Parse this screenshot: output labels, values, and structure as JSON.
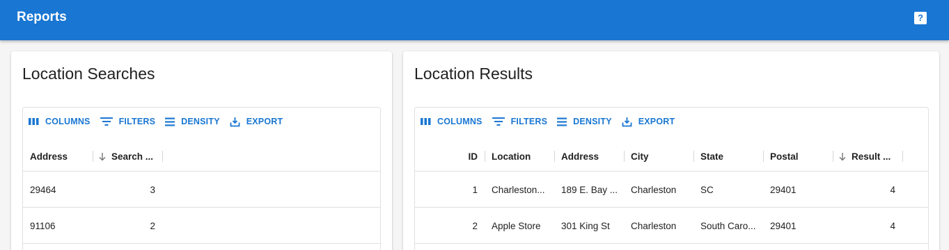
{
  "appbar": {
    "title": "Reports",
    "help_label": "?"
  },
  "toolbar": {
    "columns": "COLUMNS",
    "filters": "FILTERS",
    "density": "DENSITY",
    "export": "EXPORT"
  },
  "searches": {
    "title": "Location Searches",
    "headers": {
      "address": "Address",
      "search_count": "Search ..."
    },
    "rows": [
      {
        "address": "29464",
        "count": "3"
      },
      {
        "address": "91106",
        "count": "2"
      }
    ]
  },
  "results": {
    "title": "Location Results",
    "headers": {
      "id": "ID",
      "location": "Location",
      "address": "Address",
      "city": "City",
      "state": "State",
      "postal": "Postal",
      "result_count": "Result ..."
    },
    "rows": [
      {
        "id": "1",
        "location": "Charleston...",
        "address": "189 E. Bay ...",
        "city": "Charleston",
        "state": "SC",
        "postal": "29401",
        "count": "4"
      },
      {
        "id": "2",
        "location": "Apple Store",
        "address": "301 King St",
        "city": "Charleston",
        "state": "South Caro...",
        "postal": "29401",
        "count": "4"
      }
    ]
  },
  "colors": {
    "primary": "#1976d2",
    "background": "#f5f5f5",
    "text": "#212121"
  }
}
